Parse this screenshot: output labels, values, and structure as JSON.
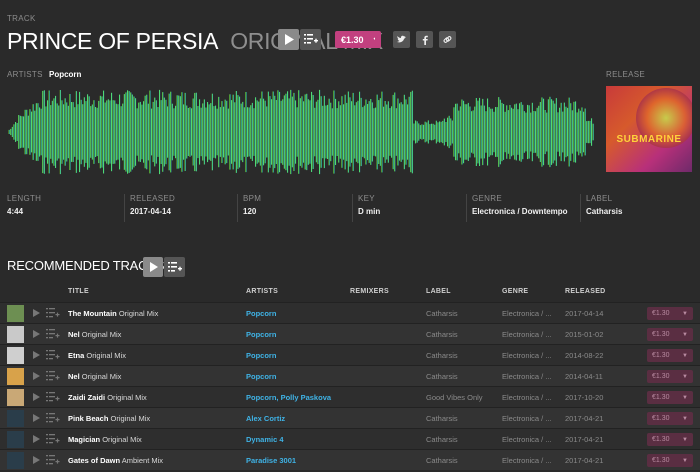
{
  "header": {
    "section_label": "TRACK",
    "title": "PRINCE OF PERSIA",
    "mix": "ORIGINAL MIX",
    "price": "€1.30",
    "artists_label": "ARTISTS",
    "artist": "Popcorn",
    "release_label": "RELEASE",
    "release_art_text": "SUBMARINE"
  },
  "icons": {
    "play": "play-icon",
    "queue": "add-to-queue-icon",
    "twitter": "twitter-icon",
    "facebook": "facebook-icon",
    "link": "link-icon",
    "dropdown": "chevron-down-icon"
  },
  "meta": [
    {
      "label": "LENGTH",
      "value": "4:44"
    },
    {
      "label": "RELEASED",
      "value": "2017-04-14"
    },
    {
      "label": "BPM",
      "value": "120"
    },
    {
      "label": "KEY",
      "value": "D min"
    },
    {
      "label": "GENRE",
      "value": "Electronica / Downtempo"
    },
    {
      "label": "LABEL",
      "value": "Catharsis"
    }
  ],
  "recommended": {
    "heading": "RECOMMENDED TRACKS",
    "columns": [
      "TITLE",
      "ARTISTS",
      "REMIXERS",
      "LABEL",
      "GENRE",
      "RELEASED"
    ],
    "rows": [
      {
        "title": "The Mountain",
        "mix": "Original Mix",
        "artists": "Popcorn",
        "remixers": "",
        "label": "Catharsis",
        "genre": "Electronica / ...",
        "released": "2017-04-14",
        "price": "€1.30"
      },
      {
        "title": "Nel",
        "mix": "Original Mix",
        "artists": "Popcorn",
        "remixers": "",
        "label": "Catharsis",
        "genre": "Electronica / ...",
        "released": "2015-01-02",
        "price": "€1.30"
      },
      {
        "title": "Etna",
        "mix": "Original Mix",
        "artists": "Popcorn",
        "remixers": "",
        "label": "Catharsis",
        "genre": "Electronica / ...",
        "released": "2014-08-22",
        "price": "€1.30"
      },
      {
        "title": "Nel",
        "mix": "Original Mix",
        "artists": "Popcorn",
        "remixers": "",
        "label": "Catharsis",
        "genre": "Electronica / ...",
        "released": "2014-04-11",
        "price": "€1.30"
      },
      {
        "title": "Zaidi Zaidi",
        "mix": "Original Mix",
        "artists": "Popcorn, Polly Paskova",
        "remixers": "",
        "label": "Good Vibes Only",
        "genre": "Electronica / ...",
        "released": "2017-10-20",
        "price": "€1.30"
      },
      {
        "title": "Pink Beach",
        "mix": "Original Mix",
        "artists": "Alex Cortiz",
        "remixers": "",
        "label": "Catharsis",
        "genre": "Electronica / ...",
        "released": "2017-04-21",
        "price": "€1.30"
      },
      {
        "title": "Magician",
        "mix": "Original Mix",
        "artists": "Dynamic 4",
        "remixers": "",
        "label": "Catharsis",
        "genre": "Electronica / ...",
        "released": "2017-04-21",
        "price": "€1.30"
      },
      {
        "title": "Gates of Dawn",
        "mix": "Ambient Mix",
        "artists": "Paradise 3001",
        "remixers": "",
        "label": "Catharsis",
        "genre": "Electronica / ...",
        "released": "2017-04-21",
        "price": "€1.30"
      }
    ],
    "thumb_colors": [
      "#6d8f52",
      "#c9c9c9",
      "#cfcfcf",
      "#d8a24a",
      "#c9a876",
      "#2a3d4a",
      "#2a3d4a",
      "#2a3d4a"
    ]
  }
}
